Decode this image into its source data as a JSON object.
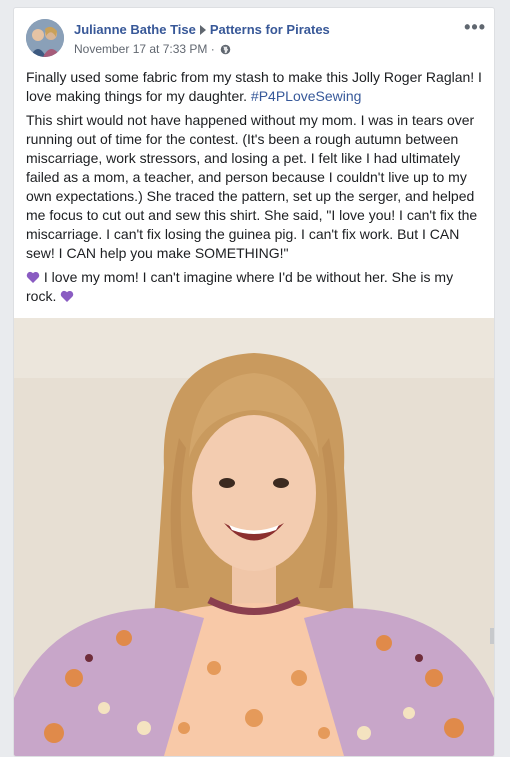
{
  "post": {
    "author": "Julianne Bathe Tise",
    "group": "Patterns for Pirates",
    "timestamp": "November 17 at 7:33 PM",
    "separator": " · ",
    "para1_text": "Finally used some fabric from my stash to make this Jolly Roger Raglan! I love making things for my daughter. ",
    "hashtag": "#P4PLoveSewing",
    "para2": "This shirt would not have happened without my mom. I was in tears over running out of time for the contest. (It's been a rough autumn between miscarriage, work stressors, and losing a pet. I felt like I had ultimately failed as a mom, a teacher, and person because I couldn't live up to my own expectations.) She traced the pattern, set up the serger, and helped me focus to cut out and sew this shirt. She said, \"I love you! I can't fix the miscarriage. I can't fix losing the guinea pig. I can't fix work. But I CAN sew! I CAN help you make SOMETHING!\"",
    "para3": " I love my mom! I can't imagine where I'd be without her. She is my rock. ",
    "more_icon": "more-options-icon",
    "privacy_icon": "globe-icon",
    "heart_icon": "purple-heart-icon"
  },
  "colors": {
    "link": "#385898",
    "heart": "#8a5cc2",
    "shirt_body": "#f8c9a8",
    "sleeve": "#c8a6c9",
    "trim": "#8b3f4f"
  }
}
